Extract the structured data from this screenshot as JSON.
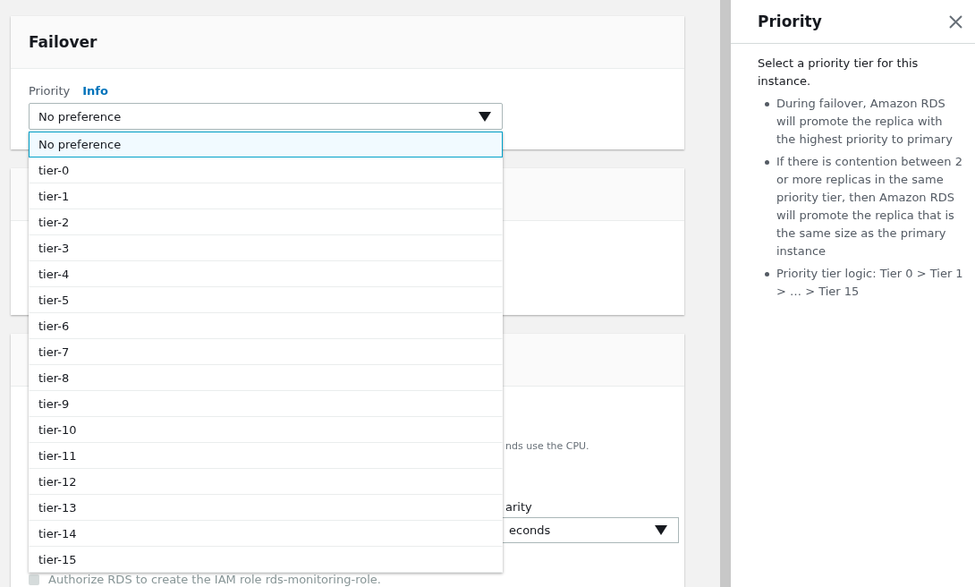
{
  "failover": {
    "title": "Failover",
    "field": {
      "label": "Priority",
      "info_link": "Info",
      "value": "No preference",
      "options": [
        {
          "label": "No preference",
          "selected": true
        },
        {
          "label": "tier-0",
          "selected": false
        },
        {
          "label": "tier-1",
          "selected": false
        },
        {
          "label": "tier-2",
          "selected": false
        },
        {
          "label": "tier-3",
          "selected": false
        },
        {
          "label": "tier-4",
          "selected": false
        },
        {
          "label": "tier-5",
          "selected": false
        },
        {
          "label": "tier-6",
          "selected": false
        },
        {
          "label": "tier-7",
          "selected": false
        },
        {
          "label": "tier-8",
          "selected": false
        },
        {
          "label": "tier-9",
          "selected": false
        },
        {
          "label": "tier-10",
          "selected": false
        },
        {
          "label": "tier-11",
          "selected": false
        },
        {
          "label": "tier-12",
          "selected": false
        },
        {
          "label": "tier-13",
          "selected": false
        },
        {
          "label": "tier-14",
          "selected": false
        },
        {
          "label": "tier-15",
          "selected": false
        }
      ]
    }
  },
  "background_card": {
    "cpu_note": "nds use the CPU.",
    "granularity_label": "arity",
    "granularity_value": "econds",
    "authorize": {
      "label": "Authorize RDS to create the IAM role rds-monitoring-role.",
      "checked": false
    }
  },
  "help_panel": {
    "title": "Priority",
    "intro": "Select a priority tier for this instance.",
    "bullets": [
      "During failover, Amazon RDS will promote the replica with the highest priority to primary",
      "If there is contention between 2 or more replicas in the same priority tier, then Amazon RDS will promote the replica that is the same size as the primary instance",
      "Priority tier logic: Tier 0 > Tier 1 > … > Tier 15"
    ]
  }
}
